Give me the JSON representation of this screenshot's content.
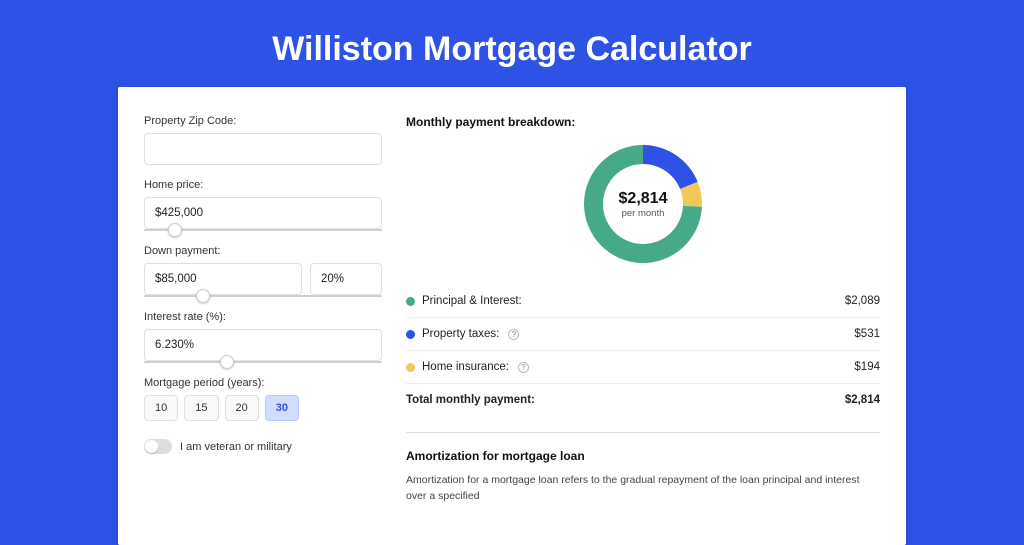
{
  "title": "Williston Mortgage Calculator",
  "form": {
    "zip": {
      "label": "Property Zip Code:",
      "value": ""
    },
    "home_price": {
      "label": "Home price:",
      "value": "$425,000",
      "slider_pct": 10
    },
    "down": {
      "label": "Down payment:",
      "amount": "$85,000",
      "pct": "20%",
      "slider_pct": 22
    },
    "rate": {
      "label": "Interest rate (%):",
      "value": "6.230%",
      "slider_pct": 32
    },
    "period": {
      "label": "Mortgage period (years):",
      "options": [
        "10",
        "15",
        "20",
        "30"
      ],
      "selected_index": 3
    },
    "veteran": {
      "label": "I am veteran or military",
      "on": false
    }
  },
  "breakdown": {
    "title": "Monthly payment breakdown:",
    "center_amount": "$2,814",
    "center_sub": "per month",
    "items": [
      {
        "label": "Principal & Interest:",
        "amount": "$2,089",
        "value": 2089,
        "color": "#46aa87",
        "has_info": false
      },
      {
        "label": "Property taxes:",
        "amount": "$531",
        "value": 531,
        "color": "#2e52e6",
        "has_info": true
      },
      {
        "label": "Home insurance:",
        "amount": "$194",
        "value": 194,
        "color": "#f1c75a",
        "has_info": true
      }
    ],
    "total": {
      "label": "Total monthly payment:",
      "amount": "$2,814",
      "value": 2814
    }
  },
  "chart_data": {
    "type": "pie",
    "title": "Monthly payment breakdown",
    "series": [
      {
        "name": "Principal & Interest",
        "value": 2089,
        "color": "#46aa87"
      },
      {
        "name": "Property taxes",
        "value": 531,
        "color": "#2e52e6"
      },
      {
        "name": "Home insurance",
        "value": 194,
        "color": "#f1c75a"
      }
    ],
    "total": 2814,
    "center_label": "$2,814 per month"
  },
  "amortization": {
    "title": "Amortization for mortgage loan",
    "text": "Amortization for a mortgage loan refers to the gradual repayment of the loan principal and interest over a specified"
  }
}
